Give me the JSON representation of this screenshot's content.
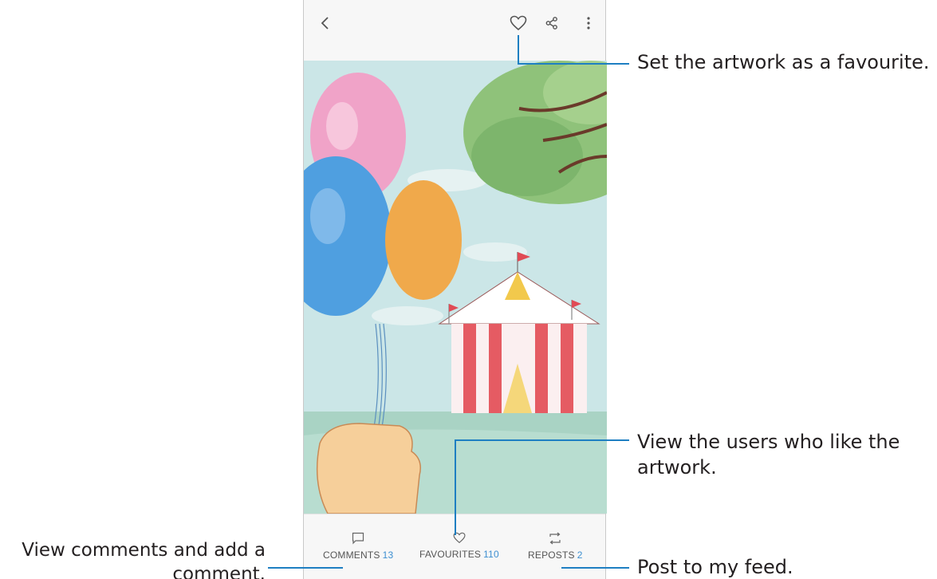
{
  "topbar": {
    "back_icon": "chevron-left-icon",
    "favourite_icon": "heart-outline-icon",
    "share_icon": "share-icon",
    "more_icon": "more-vertical-icon"
  },
  "artwork": {
    "description_icon": "artwork-image"
  },
  "stats": {
    "comments": {
      "label": "COMMENTS",
      "count": "13",
      "icon": "comment-icon"
    },
    "favourites": {
      "label": "FAVOURITES",
      "count": "110",
      "icon": "heart-outline-icon"
    },
    "reposts": {
      "label": "REPOSTS",
      "count": "2",
      "icon": "repost-icon"
    }
  },
  "annotations": {
    "favourite": "Set the artwork as a favourite.",
    "users_line1": "View the users who like the",
    "users_line2": "artwork.",
    "feed": "Post to my feed.",
    "comments_line1": "View comments and add a",
    "comments_line2": "comment."
  },
  "colors": {
    "accent": "#3d8fd1",
    "leader": "#1e7fc2",
    "sky": "#c9e4e6"
  }
}
